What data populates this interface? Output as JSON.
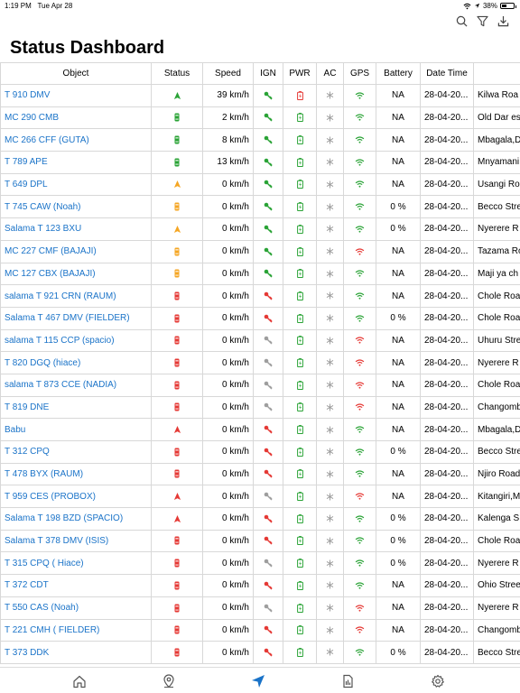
{
  "statusbar": {
    "time": "1:19 PM",
    "date": "Tue Apr 28",
    "battery": "38%",
    "battery_level": 0.38
  },
  "page": {
    "title": "Status Dashboard"
  },
  "nav_icons": [
    "search-icon",
    "filter-icon",
    "download-icon"
  ],
  "table": {
    "headers": [
      "Object",
      "Status",
      "Speed",
      "IGN",
      "PWR",
      "AC",
      "GPS",
      "Battery",
      "Date Time",
      ""
    ],
    "colors": {
      "green": "#2aa336",
      "orange": "#f5a623",
      "red": "#e53935",
      "gray": "#9e9e9e",
      "link": "#1a73c8"
    },
    "rows": [
      {
        "object": "T 910 DMV",
        "status": "moving",
        "status_color": "green",
        "speed": "39 km/h",
        "ign": "green",
        "pwr": "red",
        "ac": "gray",
        "gps": "green",
        "battery": "NA",
        "datetime": "28-04-20...",
        "location": "Kilwa Roa"
      },
      {
        "object": "MC 290 CMB",
        "status": "stopped",
        "status_color": "green",
        "speed": "2 km/h",
        "ign": "green",
        "pwr": "green",
        "ac": "gray",
        "gps": "green",
        "battery": "NA",
        "datetime": "28-04-20...",
        "location": "Old Dar es"
      },
      {
        "object": "MC 266 CFF (GUTA)",
        "status": "stopped",
        "status_color": "green",
        "speed": "8 km/h",
        "ign": "green",
        "pwr": "green",
        "ac": "gray",
        "gps": "green",
        "battery": "NA",
        "datetime": "28-04-20...",
        "location": "Mbagala,D"
      },
      {
        "object": "T 789 APE",
        "status": "stopped",
        "status_color": "green",
        "speed": "13 km/h",
        "ign": "green",
        "pwr": "green",
        "ac": "gray",
        "gps": "green",
        "battery": "NA",
        "datetime": "28-04-20...",
        "location": "Mnyamani"
      },
      {
        "object": "T 649 DPL",
        "status": "moving",
        "status_color": "orange",
        "speed": "0 km/h",
        "ign": "green",
        "pwr": "green",
        "ac": "gray",
        "gps": "green",
        "battery": "NA",
        "datetime": "28-04-20...",
        "location": "Usangi Ro"
      },
      {
        "object": "T 745 CAW  (Noah)",
        "status": "stopped",
        "status_color": "orange",
        "speed": "0 km/h",
        "ign": "green",
        "pwr": "green",
        "ac": "gray",
        "gps": "green",
        "battery": "0 %",
        "datetime": "28-04-20...",
        "location": "Becco Stre"
      },
      {
        "object": "Salama T 123 BXU",
        "status": "moving",
        "status_color": "orange",
        "speed": "0 km/h",
        "ign": "green",
        "pwr": "green",
        "ac": "gray",
        "gps": "green",
        "battery": "0 %",
        "datetime": "28-04-20...",
        "location": "Nyerere R"
      },
      {
        "object": "MC 227 CMF (BAJAJI)",
        "status": "stopped",
        "status_color": "orange",
        "speed": "0 km/h",
        "ign": "green",
        "pwr": "green",
        "ac": "gray",
        "gps": "red",
        "battery": "NA",
        "datetime": "28-04-20...",
        "location": "Tazama Ro"
      },
      {
        "object": "MC 127 CBX (BAJAJI)",
        "status": "stopped",
        "status_color": "orange",
        "speed": "0 km/h",
        "ign": "green",
        "pwr": "green",
        "ac": "gray",
        "gps": "green",
        "battery": "NA",
        "datetime": "28-04-20...",
        "location": "Maji ya ch"
      },
      {
        "object": "salama T 921 CRN (RAUM)",
        "status": "stopped",
        "status_color": "red",
        "speed": "0 km/h",
        "ign": "red",
        "pwr": "green",
        "ac": "gray",
        "gps": "green",
        "battery": "NA",
        "datetime": "28-04-20...",
        "location": "Chole Roa"
      },
      {
        "object": "Salama T 467 DMV (FIELDER)",
        "status": "stopped",
        "status_color": "red",
        "speed": "0 km/h",
        "ign": "red",
        "pwr": "green",
        "ac": "gray",
        "gps": "green",
        "battery": "0 %",
        "datetime": "28-04-20...",
        "location": "Chole Roa"
      },
      {
        "object": "salama T 115 CCP (spacio)",
        "status": "stopped",
        "status_color": "red",
        "speed": "0 km/h",
        "ign": "gray",
        "pwr": "green",
        "ac": "gray",
        "gps": "red",
        "battery": "NA",
        "datetime": "28-04-20...",
        "location": "Uhuru Stre"
      },
      {
        "object": "T 820 DGQ (hiace)",
        "status": "stopped",
        "status_color": "red",
        "speed": "0 km/h",
        "ign": "gray",
        "pwr": "green",
        "ac": "gray",
        "gps": "red",
        "battery": "NA",
        "datetime": "28-04-20...",
        "location": "Nyerere R"
      },
      {
        "object": "salama T 873 CCE (NADIA)",
        "status": "stopped",
        "status_color": "red",
        "speed": "0 km/h",
        "ign": "gray",
        "pwr": "green",
        "ac": "gray",
        "gps": "red",
        "battery": "NA",
        "datetime": "28-04-20...",
        "location": "Chole Roa"
      },
      {
        "object": "T 819 DNE",
        "status": "stopped",
        "status_color": "red",
        "speed": "0 km/h",
        "ign": "gray",
        "pwr": "green",
        "ac": "gray",
        "gps": "red",
        "battery": "NA",
        "datetime": "28-04-20...",
        "location": "Changomb"
      },
      {
        "object": "Babu",
        "status": "moving",
        "status_color": "red",
        "speed": "0 km/h",
        "ign": "red",
        "pwr": "green",
        "ac": "gray",
        "gps": "green",
        "battery": "NA",
        "datetime": "28-04-20...",
        "location": "Mbagala,D"
      },
      {
        "object": "T 312 CPQ",
        "status": "stopped",
        "status_color": "red",
        "speed": "0 km/h",
        "ign": "red",
        "pwr": "green",
        "ac": "gray",
        "gps": "green",
        "battery": "0 %",
        "datetime": "28-04-20...",
        "location": "Becco Stre"
      },
      {
        "object": "T 478 BYX (RAUM)",
        "status": "stopped",
        "status_color": "red",
        "speed": "0 km/h",
        "ign": "red",
        "pwr": "green",
        "ac": "gray",
        "gps": "green",
        "battery": "NA",
        "datetime": "28-04-20...",
        "location": "Njiro Road"
      },
      {
        "object": "T 959 CES (PROBOX)",
        "status": "moving",
        "status_color": "red",
        "speed": "0 km/h",
        "ign": "gray",
        "pwr": "green",
        "ac": "gray",
        "gps": "red",
        "battery": "NA",
        "datetime": "28-04-20...",
        "location": "Kitangiri,M"
      },
      {
        "object": "Salama T 198 BZD (SPACIO)",
        "status": "moving",
        "status_color": "red",
        "speed": "0 km/h",
        "ign": "red",
        "pwr": "green",
        "ac": "gray",
        "gps": "green",
        "battery": "0 %",
        "datetime": "28-04-20...",
        "location": "Kalenga S"
      },
      {
        "object": "Salama T 378 DMV (ISIS)",
        "status": "stopped",
        "status_color": "red",
        "speed": "0 km/h",
        "ign": "red",
        "pwr": "green",
        "ac": "gray",
        "gps": "green",
        "battery": "0 %",
        "datetime": "28-04-20...",
        "location": "Chole Roa"
      },
      {
        "object": "T 315  CPQ ( Hiace)",
        "status": "stopped",
        "status_color": "red",
        "speed": "0 km/h",
        "ign": "gray",
        "pwr": "green",
        "ac": "gray",
        "gps": "green",
        "battery": "0 %",
        "datetime": "28-04-20...",
        "location": "Nyerere R"
      },
      {
        "object": "T 372 CDT",
        "status": "stopped",
        "status_color": "red",
        "speed": "0 km/h",
        "ign": "red",
        "pwr": "green",
        "ac": "gray",
        "gps": "green",
        "battery": "NA",
        "datetime": "28-04-20...",
        "location": "Ohio Stree"
      },
      {
        "object": "T 550 CAS (Noah)",
        "status": "stopped",
        "status_color": "red",
        "speed": "0 km/h",
        "ign": "gray",
        "pwr": "green",
        "ac": "gray",
        "gps": "red",
        "battery": "NA",
        "datetime": "28-04-20...",
        "location": "Nyerere R"
      },
      {
        "object": "T 221 CMH ( FIELDER)",
        "status": "stopped",
        "status_color": "red",
        "speed": "0 km/h",
        "ign": "red",
        "pwr": "green",
        "ac": "gray",
        "gps": "red",
        "battery": "NA",
        "datetime": "28-04-20...",
        "location": "Changomb"
      },
      {
        "object": "T 373 DDK",
        "status": "stopped",
        "status_color": "red",
        "speed": "0 km/h",
        "ign": "red",
        "pwr": "green",
        "ac": "gray",
        "gps": "green",
        "battery": "0 %",
        "datetime": "28-04-20...",
        "location": "Becco Stre"
      }
    ]
  },
  "tabbar": {
    "tabs": [
      {
        "icon": "home-icon",
        "active": false
      },
      {
        "icon": "map-pin-icon",
        "active": false
      },
      {
        "icon": "navigation-arrow-icon",
        "active": true
      },
      {
        "icon": "report-icon",
        "active": false
      },
      {
        "icon": "gear-icon",
        "active": false
      }
    ],
    "active_color": "#1a73c8",
    "inactive_color": "#555555"
  }
}
